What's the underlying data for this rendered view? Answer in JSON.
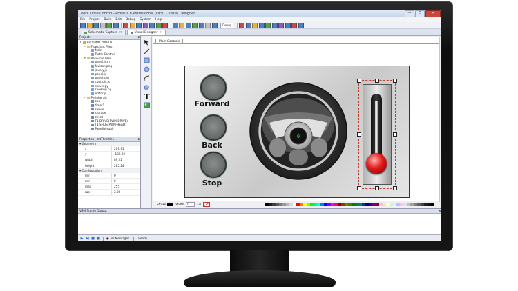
{
  "window": {
    "title": "WiFi Turtle Control - Proteus 8 Professional (DEV) - Visual Designer",
    "controls": [
      "—",
      "❐",
      "✕"
    ]
  },
  "menu": [
    "File",
    "Project",
    "Build",
    "Edit",
    "Debug",
    "System",
    "Help"
  ],
  "toolbar": {
    "debug_selection": "Debug"
  },
  "doc_tabs": [
    {
      "label": "Schematic Capture",
      "close": "✕",
      "active": false
    },
    {
      "label": "Visual Designer",
      "close": "✕",
      "active": true
    }
  ],
  "projects": {
    "header": "Projects",
    "tree": [
      {
        "label": "ARDUINO YUN(U1)",
        "depth": 0,
        "icon": "chip-icon"
      },
      {
        "label": "Flowchart Files",
        "depth": 1,
        "icon": "folder-icon"
      },
      {
        "label": "Main",
        "depth": 2,
        "icon": "file-icon"
      },
      {
        "label": "Turtle Control",
        "depth": 2,
        "icon": "file-icon"
      },
      {
        "label": "Resource Files",
        "depth": 1,
        "icon": "folder-icon"
      },
      {
        "label": "panel.htm",
        "depth": 2,
        "icon": "file-icon"
      },
      {
        "label": "favicon.png",
        "depth": 2,
        "icon": "file-icon"
      },
      {
        "label": "jquery.js",
        "depth": 2,
        "icon": "file-icon"
      },
      {
        "label": "panel.js",
        "depth": 2,
        "icon": "file-icon"
      },
      {
        "label": "panel.svg",
        "depth": 2,
        "icon": "file-icon"
      },
      {
        "label": "controls.js",
        "depth": 2,
        "icon": "file-icon"
      },
      {
        "label": "server.py",
        "depth": 2,
        "icon": "file-icon"
      },
      {
        "label": "showlog.py",
        "depth": 2,
        "icon": "file-icon"
      },
      {
        "label": "editor.js",
        "depth": 2,
        "icon": "file-icon"
      },
      {
        "label": "Peripherals",
        "depth": 1,
        "icon": "folder-icon"
      },
      {
        "label": "cpu",
        "depth": 2,
        "icon": "gear-icon"
      },
      {
        "label": "timer1",
        "depth": 2,
        "icon": "gear-icon"
      },
      {
        "label": "server",
        "depth": 2,
        "icon": "gear-icon"
      },
      {
        "label": "storage",
        "depth": 2,
        "icon": "gear-icon"
      },
      {
        "label": "client",
        "depth": 2,
        "icon": "gear-icon"
      },
      {
        "label": "T1 DRIVE(PWM-DRIVE)",
        "depth": 2,
        "icon": "gear-icon"
      },
      {
        "label": "T1 SHOS(PWM-HEAD)",
        "depth": 2,
        "icon": "gear-icon"
      },
      {
        "label": "Panel(Visual)",
        "depth": 2,
        "icon": "gear-icon"
      }
    ]
  },
  "properties": {
    "header": "Properties - txtThrottle1",
    "groups": [
      {
        "name": "Geometry",
        "rows": [
          {
            "key": "x",
            "value": "209.91"
          },
          {
            "key": "y",
            "value": "-139.92"
          },
          {
            "key": "width",
            "value": "89.22"
          },
          {
            "key": "height",
            "value": "285.24"
          }
        ]
      },
      {
        "name": "Configuration",
        "rows": [
          {
            "key": "min",
            "value": "0"
          },
          {
            "key": "min",
            "value": "0"
          },
          {
            "key": "max",
            "value": "255"
          },
          {
            "key": "rate",
            "value": "2.00"
          }
        ]
      }
    ]
  },
  "designer": {
    "tab": "Main Controls",
    "buttons": [
      "Forward",
      "Back",
      "Stop"
    ],
    "wheel_readout": "0",
    "stroke_bar": {
      "stroke_label": "Stroke",
      "width_label": "Width",
      "width_value": "1",
      "fill_label": "Fill"
    }
  },
  "vsm_output": {
    "header": "VSM Studio Output"
  },
  "status": {
    "messages": "No Messages",
    "state": "Ready"
  },
  "colors": {
    "palette": [
      "#000000",
      "#1f1f1f",
      "#3d3d3d",
      "#5c5c5c",
      "#7a7a7a",
      "#999999",
      "#b8b8b8",
      "#d6d6d6",
      "#ffffff",
      "#ff0000",
      "#ff7f00",
      "#ffff00",
      "#7fff00",
      "#00ff00",
      "#00ff7f",
      "#00ffff",
      "#007fff",
      "#0000ff",
      "#7f00ff",
      "#ff00ff",
      "#ff007f",
      "#7f0000",
      "#7f3f00",
      "#7f7f00",
      "#3f7f00",
      "#007f00",
      "#007f3f",
      "#007f7f",
      "#003f7f",
      "#00007f",
      "#3f007f",
      "#7f007f",
      "#7f003f",
      "#ffbfbf",
      "#ffdfbf",
      "#ffffbf",
      "#bfffbf",
      "#bfffff",
      "#bfbfff",
      "#ffbfff",
      "#e0e0e0",
      "#c0c0c0",
      "#a0a0a0",
      "#808080",
      "#606060",
      "#404040",
      "#202020",
      "#101010",
      "#000000"
    ],
    "toolbar_icons": [
      "#4a7fc0",
      "#e6b23a",
      "#4a7fc0",
      "#c0c0c0",
      "#5aa04a",
      "#4a7fc0",
      "#c84a4a",
      "#e6b23a",
      "#4a7fc0",
      "#8a5ac0",
      "#4a7fc0",
      "#5aa04a",
      "#c84a4a",
      "#4a7fc0",
      "#e6b23a",
      "#4a7fc0",
      "#5aa04a",
      "#4a7fc0",
      "#c0c0c0",
      "#4a7fc0",
      "#c84a4a",
      "#4a7fc0",
      "#e6b23a",
      "#4a7fc0",
      "#5aa04a",
      "#4a7fc0",
      "#8a5ac0",
      "#4a7fc0",
      "#c84a4a",
      "#4a7fc0"
    ]
  }
}
